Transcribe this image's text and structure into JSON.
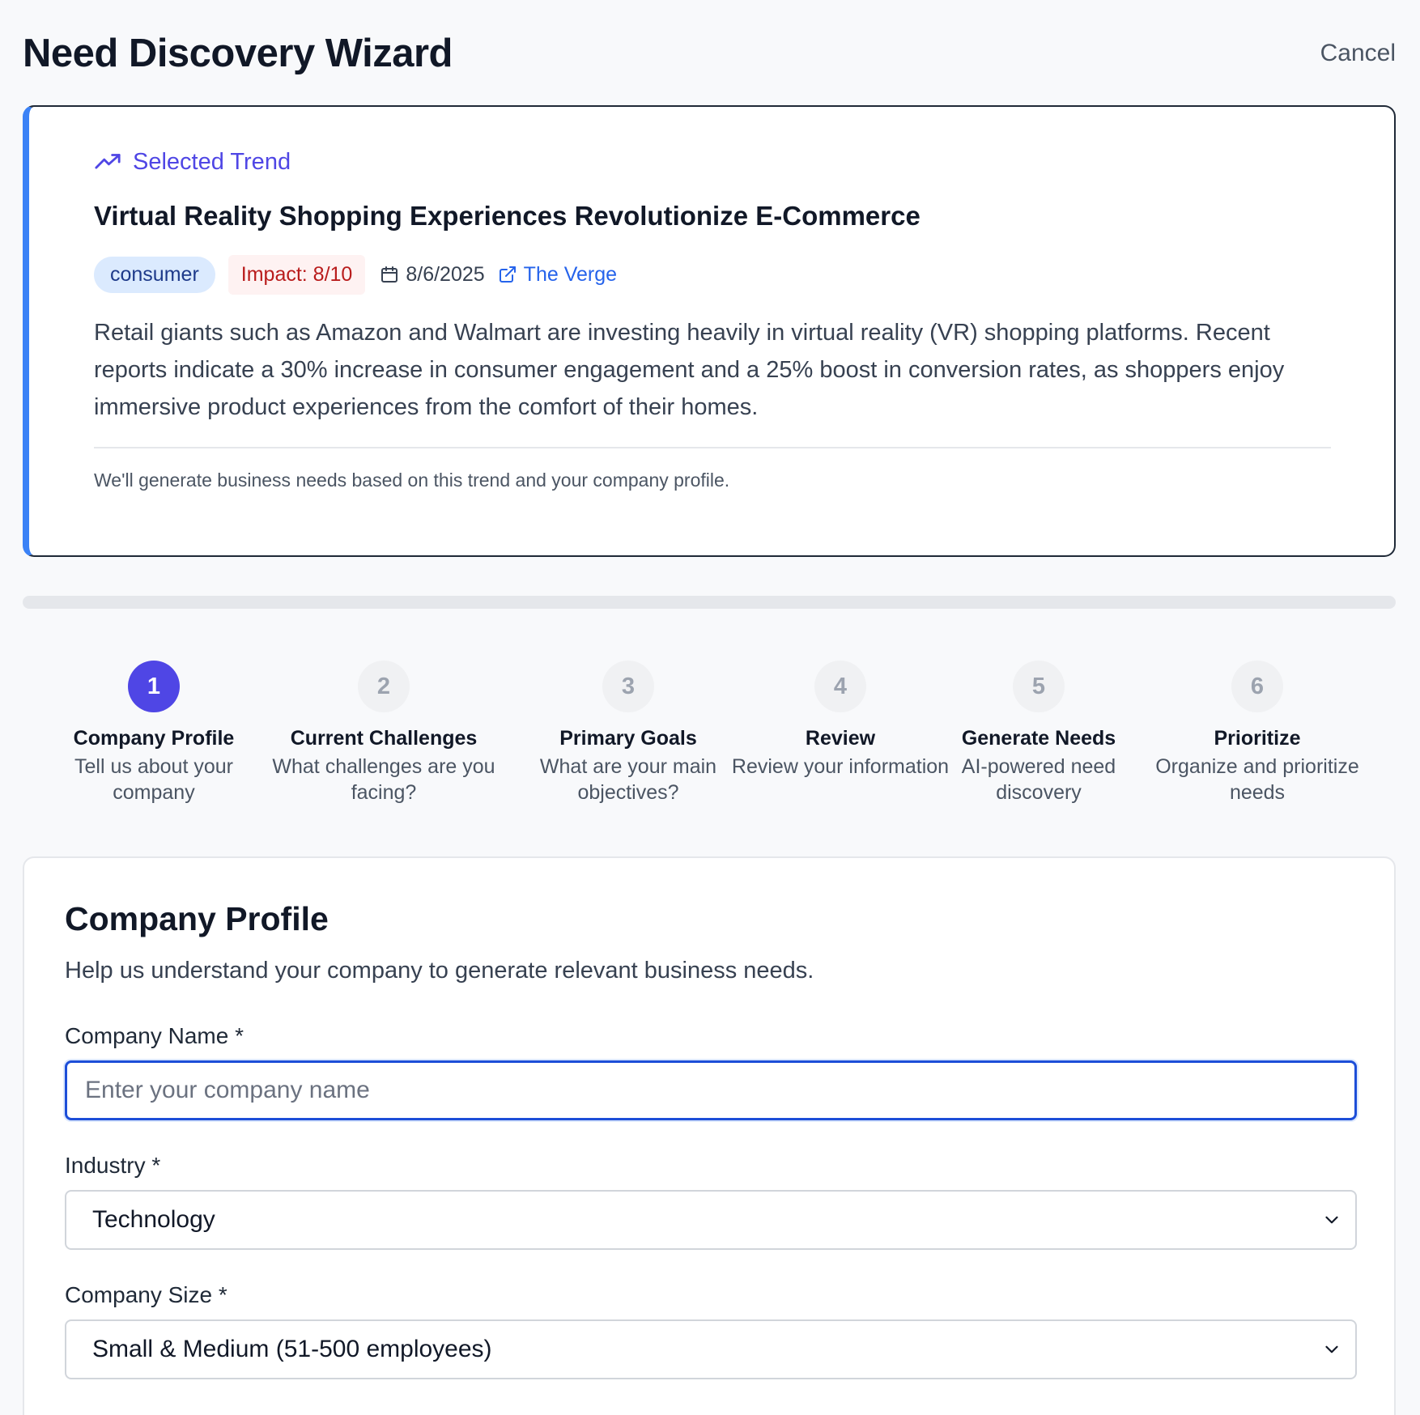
{
  "header": {
    "title": "Need Discovery Wizard",
    "cancel_label": "Cancel"
  },
  "trend": {
    "section_label": "Selected Trend",
    "title": "Virtual Reality Shopping Experiences Revolutionize E-Commerce",
    "category": "consumer",
    "impact": "Impact: 8/10",
    "date": "8/6/2025",
    "source": "The Verge",
    "description": "Retail giants such as Amazon and Walmart are investing heavily in virtual reality (VR) shopping platforms. Recent reports indicate a 30% increase in consumer engagement and a 25% boost in conversion rates, as shoppers enjoy immersive product experiences from the comfort of their homes.",
    "note": "We'll generate business needs based on this trend and your company profile.",
    "icons": {
      "label": "trending-up-icon",
      "date": "calendar-icon",
      "source": "external-link-icon"
    }
  },
  "progress": {
    "fraction": 0.0
  },
  "steps": [
    {
      "number": "1",
      "title": "Company Profile",
      "desc": "Tell us about your company",
      "active": true
    },
    {
      "number": "2",
      "title": "Current Challenges",
      "desc": "What challenges are you facing?",
      "active": false
    },
    {
      "number": "3",
      "title": "Primary Goals",
      "desc": "What are your main objectives?",
      "active": false
    },
    {
      "number": "4",
      "title": "Review",
      "desc": "Review your information",
      "active": false
    },
    {
      "number": "5",
      "title": "Generate Needs",
      "desc": "AI-powered need discovery",
      "active": false
    },
    {
      "number": "6",
      "title": "Prioritize",
      "desc": "Organize and prioritize needs",
      "active": false
    }
  ],
  "form": {
    "title": "Company Profile",
    "subtitle": "Help us understand your company to generate relevant business needs.",
    "company_name": {
      "label": "Company Name *",
      "value": "",
      "placeholder": "Enter your company name"
    },
    "industry": {
      "label": "Industry *",
      "value": "Technology"
    },
    "company_size": {
      "label": "Company Size *",
      "value": "Small & Medium (51-500 employees)"
    }
  },
  "colors": {
    "accent": "#4f46e5",
    "link": "#2563eb",
    "card_stripe": "#3b82f6",
    "impact_text": "#b91c1c",
    "badge_bg": "#dbeafe"
  }
}
